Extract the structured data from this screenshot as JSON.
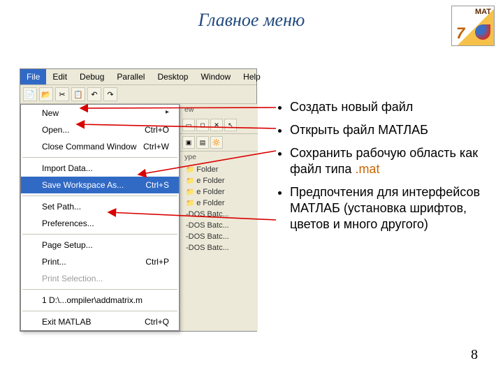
{
  "title": "Главное меню",
  "logo": {
    "brand": "MAT",
    "version": "7"
  },
  "pageNumber": "8",
  "menubar": [
    "File",
    "Edit",
    "Debug",
    "Parallel",
    "Desktop",
    "Window",
    "Help"
  ],
  "toolbar_icons": [
    "📄",
    "📂",
    "✂",
    "📋",
    "↶",
    "↷"
  ],
  "file_menu": {
    "new": {
      "label": "New"
    },
    "open": {
      "label": "Open...",
      "short": "Ctrl+O"
    },
    "closecmd": {
      "label": "Close Command Window",
      "short": "Ctrl+W"
    },
    "import": {
      "label": "Import Data..."
    },
    "savews": {
      "label": "Save Workspace As...",
      "short": "Ctrl+S"
    },
    "setpath": {
      "label": "Set Path..."
    },
    "prefs": {
      "label": "Preferences..."
    },
    "pagesetup": {
      "label": "Page Setup..."
    },
    "print": {
      "label": "Print...",
      "short": "Ctrl+P"
    },
    "printsel": {
      "label": "Print Selection..."
    },
    "recent": {
      "label": "1 D:\\...ompiler\\addmatrix.m"
    },
    "exit": {
      "label": "Exit MATLAB",
      "short": "Ctrl+Q"
    }
  },
  "behind": {
    "tabNew": "ew",
    "toolstrip": [
      "▭",
      "◻",
      "✕",
      "↖"
    ],
    "typeHeader": "ype",
    "rows": [
      "Folder",
      "e Folder",
      "e Folder",
      "e Folder",
      "-DOS Batc...",
      "-DOS Batc...",
      "-DOS Batc...",
      "-DOS Batc..."
    ]
  },
  "bullets": [
    "Создать новый файл",
    "Открыть файл МАТЛАБ",
    "Сохранить рабочую область как файл типа ",
    "Предпочтения для интерфейсов МАТЛАБ (установка  шрифтов, цветов и много другого)"
  ],
  "mat_ext": ".mat"
}
